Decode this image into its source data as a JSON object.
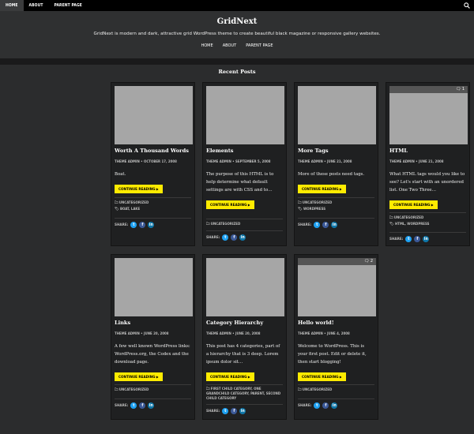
{
  "topnav": {
    "items": [
      "HOME",
      "ABOUT",
      "PARENT PAGE"
    ],
    "search_icon": "search-icon"
  },
  "header": {
    "title": "GridNext",
    "description": "GridNext is modern and dark, attractive grid WordPress theme to create beautiful black magazine or responsive gallery websites.",
    "menu": [
      "HOME",
      "ABOUT",
      "PARENT PAGE"
    ]
  },
  "section": {
    "title": "Recent Posts"
  },
  "share_label": "SHARE:",
  "read_more": "CONTINUE READING",
  "posts": [
    {
      "title": "Worth A Thousand Words",
      "meta": "THEME ADMIN  •  OCTOBER 17, 2008",
      "excerpt": "Boat.",
      "categories": "UNCATEGORIZED",
      "tags": "BOAT, LAKE"
    },
    {
      "title": "Elements",
      "meta": "THEME ADMIN  •  SEPTEMBER 5, 2008",
      "excerpt": "The purpose of this HTML is to help determine what default settings are with CSS and to…",
      "categories": "UNCATEGORIZED",
      "tags": ""
    },
    {
      "title": "More Tags",
      "meta": "THEME ADMIN  •  JUNE 21, 2008",
      "excerpt": "More of these posts need tags.",
      "categories": "UNCATEGORIZED",
      "tags": "WORDPRESS"
    },
    {
      "title": "HTML",
      "meta": "THEME ADMIN  •  JUNE 21, 2008",
      "excerpt": "What HTML tags would you like to see? Let's start with an unordered list. One Two Three…",
      "categories": "UNCATEGORIZED",
      "tags": "HTML, WORDPRESS",
      "comments": "1"
    },
    {
      "title": "Links",
      "meta": "THEME ADMIN  •  JUNE 20, 2008",
      "excerpt": "A few well known WordPress links: WordPress.org, the Codex and the download page.",
      "categories": "UNCATEGORIZED",
      "tags": ""
    },
    {
      "title": "Category Hierarchy",
      "meta": "THEME ADMIN  •  JUNE 20, 2008",
      "excerpt": "This post has 4 categories, part of a hierarchy that is 3 deep. Lorem ipsum dolor sit…",
      "categories": "FIRST CHILD CATEGORY, ONE GRANDCHILD CATEGORY, PARENT, SECOND CHILD CATEGORY",
      "tags": ""
    },
    {
      "title": "Hello world!",
      "meta": "THEME ADMIN  •  JUNE 4, 2008",
      "excerpt": "Welcome to WordPress. This is your first post. Edit or delete it, then start blogging!",
      "categories": "UNCATEGORIZED",
      "tags": "",
      "comments": "2"
    }
  ]
}
